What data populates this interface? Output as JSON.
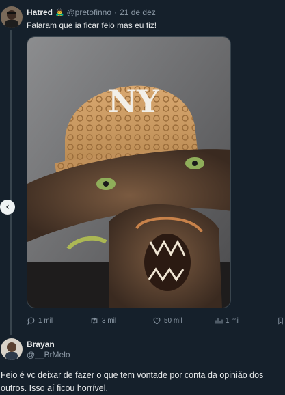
{
  "tweet1": {
    "name": "Hatred",
    "verified_emoji": "🙇‍♂️",
    "handle": "@pretofinno",
    "separator": "·",
    "date": "21 de dez",
    "text": "Falaram que ia ficar feio mas eu fiz!",
    "actions": {
      "replies": "1 mil",
      "retweets": "3 mil",
      "likes": "50 mil",
      "views": "1 mi"
    }
  },
  "tweet2": {
    "name": "Brayan",
    "handle": "@__BrMelo",
    "text": "Feio é vc deixar de fazer o que tem vontade por conta da opinião dos outros. Isso aí ficou horrível."
  },
  "nav": {
    "prev_arrow": "‹"
  },
  "colors": {
    "background": "#15202b",
    "muted": "#8b98a5",
    "text": "#e7e9ea",
    "line": "#38444d"
  }
}
